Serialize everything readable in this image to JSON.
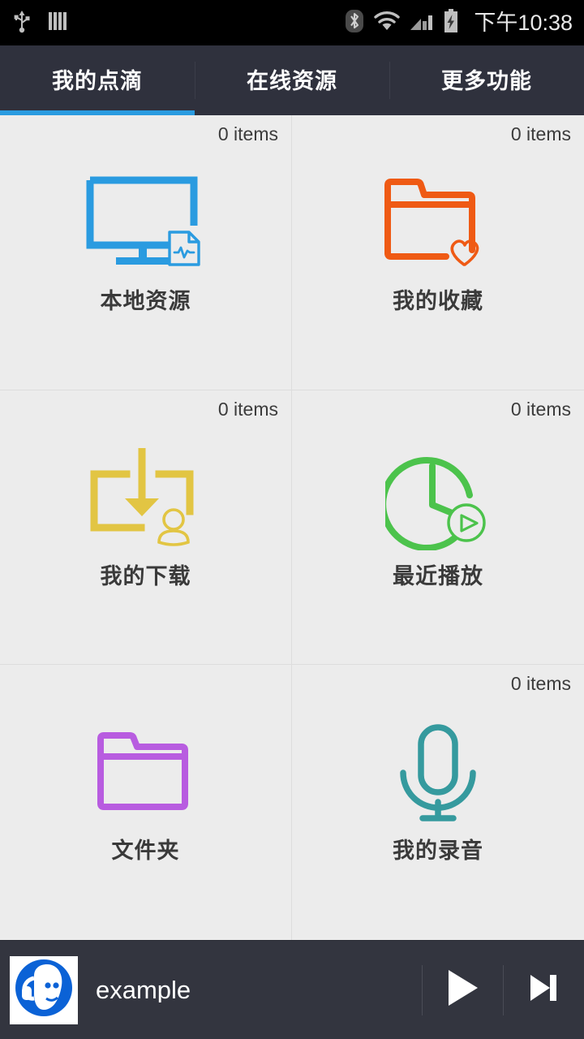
{
  "statusbar": {
    "time": "下午10:38",
    "left_icons": [
      "usb-icon",
      "vibrate-bars-icon"
    ],
    "right_icons": [
      "bluetooth-icon",
      "wifi-icon",
      "cellular-signal-icon",
      "battery-charging-icon"
    ]
  },
  "tabs": [
    {
      "label": "我的点滴",
      "active": true
    },
    {
      "label": "在线资源",
      "active": false
    },
    {
      "label": "更多功能",
      "active": false
    }
  ],
  "grid": {
    "cells": [
      {
        "label": "本地资源",
        "count": "0 items",
        "icon": "monitor-file-icon",
        "color": "#2A9BE0",
        "show_count": true
      },
      {
        "label": "我的收藏",
        "count": "0 items",
        "icon": "folder-heart-icon",
        "color": "#EF5A14",
        "show_count": true
      },
      {
        "label": "我的下载",
        "count": "0 items",
        "icon": "download-user-icon",
        "color": "#E2C543",
        "show_count": true
      },
      {
        "label": "最近播放",
        "count": "0 items",
        "icon": "clock-play-icon",
        "color": "#4CC34C",
        "show_count": true
      },
      {
        "label": "文件夹",
        "count": "",
        "icon": "folder-icon",
        "color": "#B85CE0",
        "show_count": false
      },
      {
        "label": "我的录音",
        "count": "0 items",
        "icon": "microphone-icon",
        "color": "#359A9E",
        "show_count": true
      }
    ]
  },
  "player": {
    "title": "example",
    "art_icon": "headphones-avatar-icon",
    "play_label": "play-icon",
    "next_label": "next-track-icon"
  },
  "colors": {
    "accent": "#2A9BE0",
    "tabbar_bg": "#2F313D",
    "player_bg": "#33353F",
    "page_bg": "#ECECEC"
  }
}
